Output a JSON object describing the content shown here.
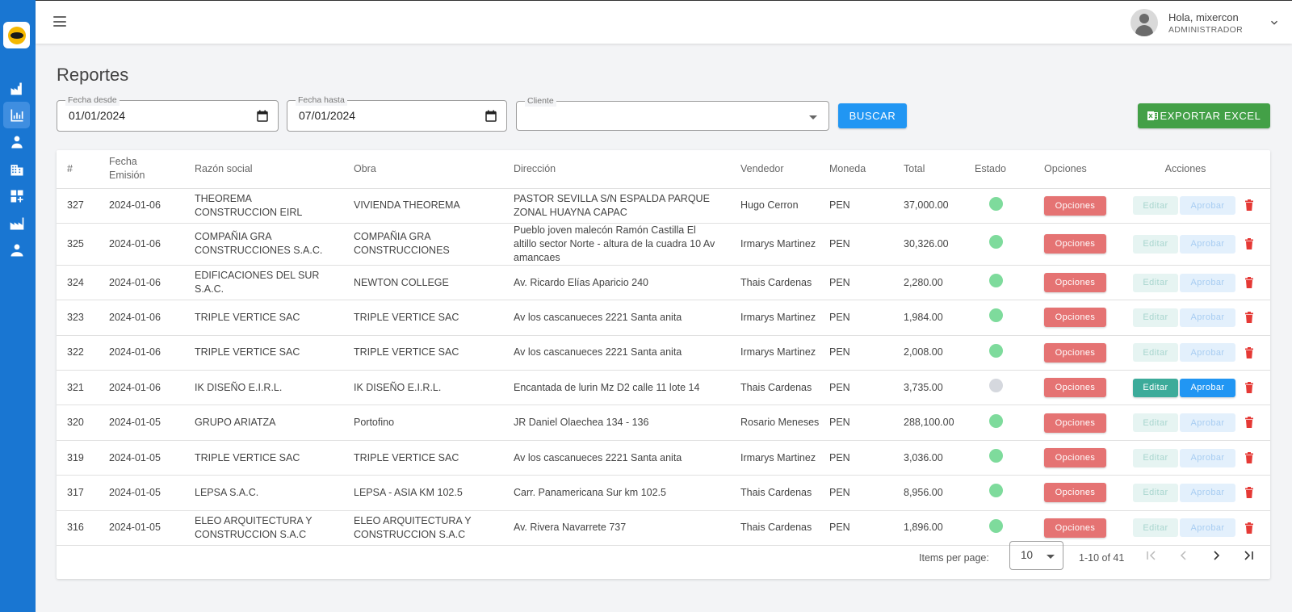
{
  "user": {
    "greeting": "Hola, mixercon",
    "role": "ADMINISTRADOR"
  },
  "page": {
    "title": "Reportes"
  },
  "filters": {
    "fecha_desde": {
      "label": "Fecha desde",
      "value": "01/01/2024"
    },
    "fecha_hasta": {
      "label": "Fecha hasta",
      "value": "07/01/2024"
    },
    "cliente": {
      "label": "Cliente",
      "value": ""
    },
    "buscar_label": "BUSCAR",
    "exportar_label": "EXPORTAR EXCEL"
  },
  "table": {
    "headers": {
      "num": "#",
      "fecha": "Fecha Emisión",
      "razon": "Razón social",
      "obra": "Obra",
      "direccion": "Dirección",
      "vendedor": "Vendedor",
      "moneda": "Moneda",
      "total": "Total",
      "estado": "Estado",
      "opciones": "Opciones",
      "acciones": "Acciones"
    },
    "rows": [
      {
        "num": "327",
        "fecha": "2024-01-06",
        "razon": "THEOREMA CONSTRUCCION EIRL",
        "obra": "VIVIENDA THEOREMA",
        "direccion": "PASTOR SEVILLA S/N ESPALDA PARQUE ZONAL HUAYNA CAPAC",
        "vendedor": "Hugo Cerron",
        "moneda": "PEN",
        "total": "37,000.00",
        "estado": "approved",
        "opciones": "Opciones",
        "editar": "Editar",
        "aprobar": "Aprobar",
        "actions_enabled": false
      },
      {
        "num": "325",
        "fecha": "2024-01-06",
        "razon": "COMPAÑIA GRA CONSTRUCCIONES S.A.C.",
        "obra": "COMPAÑIA GRA CONSTRUCCIONES",
        "direccion": "Pueblo joven malecón Ramón Castilla El altillo sector Norte - altura de la cuadra 10 Av amancaes",
        "vendedor": "Irmarys Martinez",
        "moneda": "PEN",
        "total": "30,326.00",
        "estado": "approved",
        "opciones": "Opciones",
        "editar": "Editar",
        "aprobar": "Aprobar",
        "actions_enabled": false
      },
      {
        "num": "324",
        "fecha": "2024-01-06",
        "razon": "EDIFICACIONES DEL SUR S.A.C.",
        "obra": "NEWTON COLLEGE",
        "direccion": "Av. Ricardo Elías Aparicio 240",
        "vendedor": "Thais Cardenas",
        "moneda": "PEN",
        "total": "2,280.00",
        "estado": "approved",
        "opciones": "Opciones",
        "editar": "Editar",
        "aprobar": "Aprobar",
        "actions_enabled": false
      },
      {
        "num": "323",
        "fecha": "2024-01-06",
        "razon": "TRIPLE VERTICE SAC",
        "obra": "TRIPLE VERTICE SAC",
        "direccion": "Av los cascanueces 2221 Santa anita",
        "vendedor": "Irmarys Martinez",
        "moneda": "PEN",
        "total": "1,984.00",
        "estado": "approved",
        "opciones": "Opciones",
        "editar": "Editar",
        "aprobar": "Aprobar",
        "actions_enabled": false
      },
      {
        "num": "322",
        "fecha": "2024-01-06",
        "razon": "TRIPLE VERTICE SAC",
        "obra": "TRIPLE VERTICE SAC",
        "direccion": "Av los cascanueces 2221 Santa anita",
        "vendedor": "Irmarys Martinez",
        "moneda": "PEN",
        "total": "2,008.00",
        "estado": "approved",
        "opciones": "Opciones",
        "editar": "Editar",
        "aprobar": "Aprobar",
        "actions_enabled": false
      },
      {
        "num": "321",
        "fecha": "2024-01-06",
        "razon": "IK DISEÑO E.I.R.L.",
        "obra": "IK DISEÑO E.I.R.L.",
        "direccion": "Encantada de lurin Mz D2 calle 11 lote 14",
        "vendedor": "Thais Cardenas",
        "moneda": "PEN",
        "total": "3,735.00",
        "estado": "pending",
        "opciones": "Opciones",
        "editar": "Editar",
        "aprobar": "Aprobar",
        "actions_enabled": true
      },
      {
        "num": "320",
        "fecha": "2024-01-05",
        "razon": "GRUPO ARIATZA",
        "obra": "Portofino",
        "direccion": "JR Daniel Olaechea 134 - 136",
        "vendedor": "Rosario Meneses",
        "moneda": "PEN",
        "total": "288,100.00",
        "estado": "approved",
        "opciones": "Opciones",
        "editar": "Editar",
        "aprobar": "Aprobar",
        "actions_enabled": false
      },
      {
        "num": "319",
        "fecha": "2024-01-05",
        "razon": "TRIPLE VERTICE SAC",
        "obra": "TRIPLE VERTICE SAC",
        "direccion": "Av los cascanueces 2221 Santa anita",
        "vendedor": "Irmarys Martinez",
        "moneda": "PEN",
        "total": "3,036.00",
        "estado": "approved",
        "opciones": "Opciones",
        "editar": "Editar",
        "aprobar": "Aprobar",
        "actions_enabled": false
      },
      {
        "num": "317",
        "fecha": "2024-01-05",
        "razon": "LEPSA S.A.C.",
        "obra": "LEPSA - ASIA KM 102.5",
        "direccion": "Carr. Panamericana Sur km 102.5",
        "vendedor": "Thais Cardenas",
        "moneda": "PEN",
        "total": "8,956.00",
        "estado": "approved",
        "opciones": "Opciones",
        "editar": "Editar",
        "aprobar": "Aprobar",
        "actions_enabled": false
      },
      {
        "num": "316",
        "fecha": "2024-01-05",
        "razon": "ELEO ARQUITECTURA Y CONSTRUCCION S.A.C",
        "obra": "ELEO ARQUITECTURA Y CONSTRUCCION S.A.C",
        "direccion": "Av. Rivera Navarrete 737",
        "vendedor": "Thais Cardenas",
        "moneda": "PEN",
        "total": "1,896.00",
        "estado": "approved",
        "opciones": "Opciones",
        "editar": "Editar",
        "aprobar": "Aprobar",
        "actions_enabled": false
      }
    ]
  },
  "paginator": {
    "items_label": "Items per page:",
    "page_size": "10",
    "range": "1-10 of 41"
  },
  "colors": {
    "sidebar": "#1976d2",
    "estado_approved": "#7edb9c",
    "estado_pending": "#d5d8de",
    "opciones": "#e57373",
    "export": "#43a047",
    "buscar": "#2196f3"
  },
  "icons": {
    "sidebar": [
      "factory-icon",
      "bar-chart-icon",
      "user-icon",
      "building-icon",
      "category-add-icon",
      "industry-icon",
      "users-icon"
    ]
  }
}
